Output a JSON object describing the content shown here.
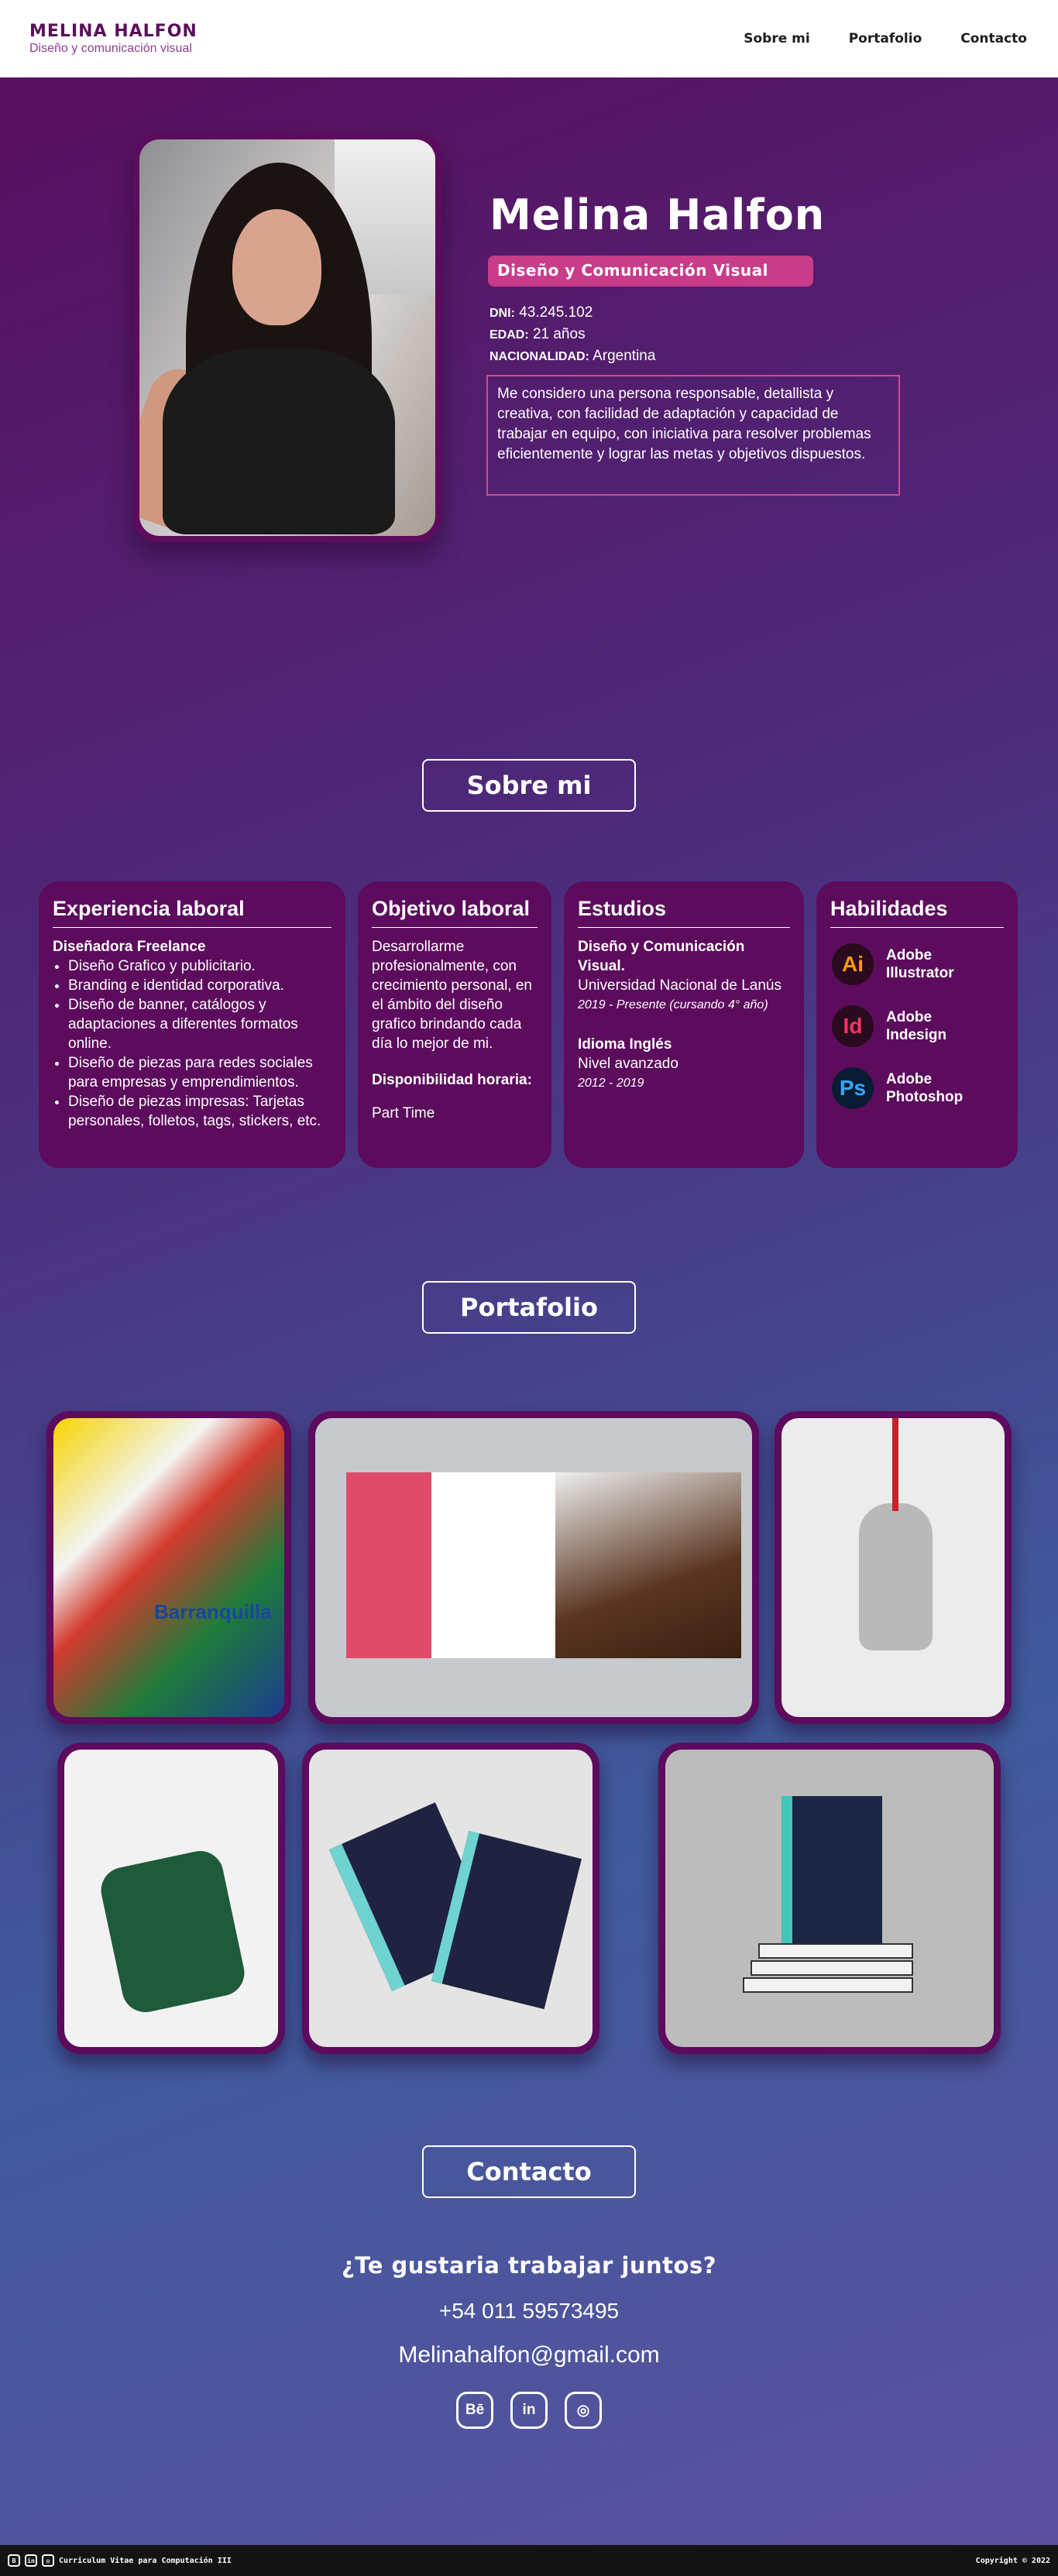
{
  "header": {
    "brand_name": "MELINA HALFON",
    "brand_sub": "Diseño y comunicación visual",
    "nav": [
      "Sobre mi",
      "Portafolio",
      "Contacto"
    ]
  },
  "hero": {
    "photo_icon": "profile-photo",
    "name": "Melina Halfon",
    "role": "Diseño y Comunicación Visual",
    "dni_label": "DNI:",
    "dni": "43.245.102",
    "age_label": "EDAD:",
    "age": "21 años",
    "nationality_label": "NACIONALIDAD:",
    "nationality": "Argentina",
    "about": "Me considero una persona responsable, detallista y creativa, con facilidad de adaptación y capacidad de trabajar en equipo, con iniciativa para resolver problemas eficientemente y lograr las metas y objetivos dispuestos."
  },
  "sobre_title": "Sobre mi",
  "experience": {
    "title": "Experiencia laboral",
    "role": "Diseñadora Freelance",
    "items": [
      "Diseño Grafico y publicitario.",
      "Branding e identidad corporativa.",
      "Diseño de banner, catálogos y adaptaciones a diferentes formatos online.",
      "Diseño de piezas para redes sociales para empresas y emprendimientos.",
      "Diseño de piezas impresas: Tarjetas personales, folletos, tags, stickers, etc."
    ]
  },
  "objective": {
    "title": "Objetivo laboral",
    "text": "Desarrollarme profesionalmente, con crecimiento personal, en el ámbito del diseño grafico brindando cada día lo mejor de mi.",
    "availability_label": "Disponibilidad horaria:",
    "availability": "Part Time"
  },
  "studies": {
    "title": "Estudios",
    "degree": "Diseño y Comunicación Visual.",
    "school": "Universidad Nacional de Lanús",
    "years1": "2019 - Presente (cursando 4° año)",
    "language": "Idioma Inglés",
    "level": "Nivel avanzado",
    "years2": "2012 - 2019"
  },
  "skills": {
    "title": "Habilidades",
    "items": [
      {
        "abbr": "Ai",
        "label": "Adobe Illustrator",
        "color": "#ff9a00"
      },
      {
        "abbr": "Id",
        "label": "Adobe Indesign",
        "color": "#ff3366"
      },
      {
        "abbr": "Ps",
        "label": "Adobe Photoshop",
        "color": "#31a8ff"
      }
    ]
  },
  "portfolio_title": "Portafolio",
  "portfolio": {
    "caption1": "Barranquilla"
  },
  "contact_title": "Contacto",
  "contact": {
    "heading": "¿Te gustaria trabajar juntos?",
    "phone": "+54 011 59573495",
    "email": "Melinahalfon@gmail.com",
    "socials": [
      "Bē",
      "in",
      "◎"
    ]
  },
  "footer": {
    "left": "Curriculum Vitae para Computación III",
    "right": "Copyright © 2022"
  }
}
